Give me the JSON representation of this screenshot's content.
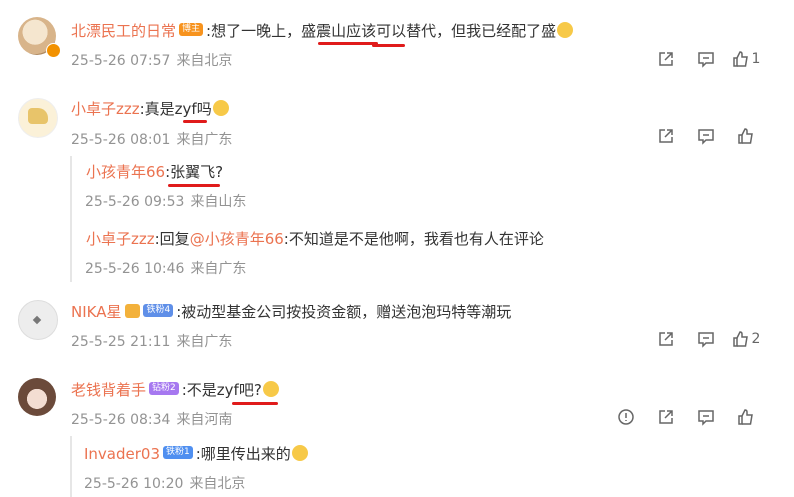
{
  "comments": [
    {
      "name": "北漂民工的日常",
      "badge": "博主",
      "text": ":想了一晚上，盛震山应该可以替代，但我已经配了盛",
      "date": "25-5-26 07:57",
      "source": "来自北京",
      "likes": "1"
    },
    {
      "name": "小卓子zzz",
      "text": ":真是zyf吗",
      "date": "25-5-26 08:01",
      "source": "来自广东",
      "replies": [
        {
          "name": "小孩青年66",
          "text": ":张翼飞?",
          "date": "25-5-26 09:53",
          "source": "来自山东"
        },
        {
          "name": "小卓子zzz",
          "text_prefix": ":回复",
          "mention": "@小孩青年66",
          "text": ":不知道是不是他啊，我看也有人在评论",
          "date": "25-5-26 10:46",
          "source": "来自广东"
        }
      ]
    },
    {
      "name": "NIKA星",
      "badge": "铁粉4",
      "text": ":被动型基金公司按投资金额，赠送泡泡玛特等潮玩",
      "date": "25-5-25 21:11",
      "source": "来自广东",
      "likes": "2"
    },
    {
      "name": "老钱背着手",
      "badge": "钻粉2",
      "text": ":不是zyf吧?",
      "date": "25-5-26 08:34",
      "source": "来自河南",
      "replies": [
        {
          "name": "Invader03",
          "badge": "铁粉1",
          "text": ":哪里传出来的",
          "date": "25-5-26 10:20",
          "source": "来自北京"
        }
      ]
    }
  ],
  "colors": {
    "name": "#eb7350",
    "meta": "#939393",
    "underline": "#e01b1b"
  },
  "icons": [
    "share-icon",
    "comment-icon",
    "like-icon",
    "report-icon"
  ]
}
